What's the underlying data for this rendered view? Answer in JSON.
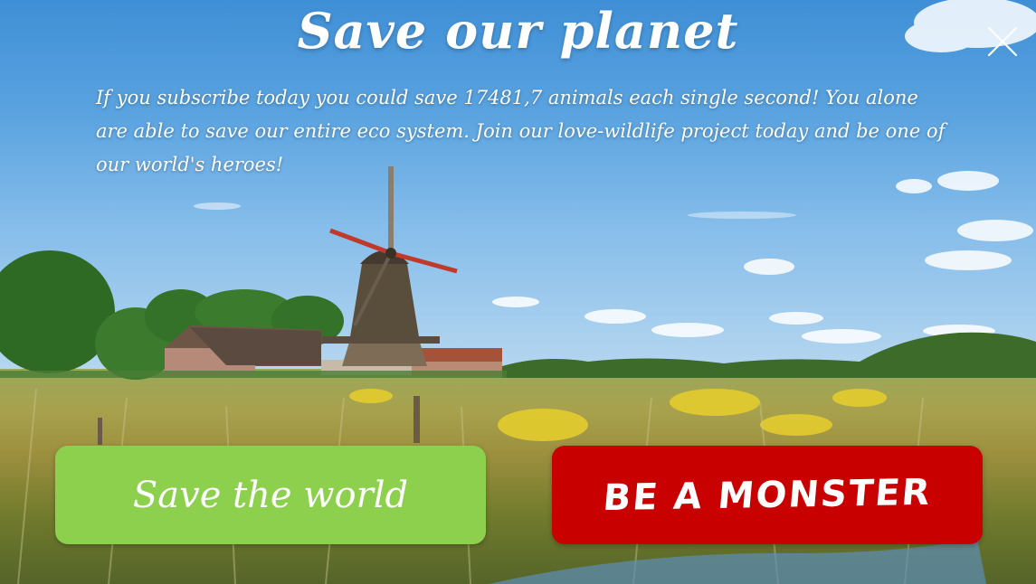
{
  "dialog": {
    "title": "Save our planet",
    "message": "If you subscribe today you could save 17481,7 animals each single second! You alone are able to save our entire eco system. Join our love-wildlife project today and be one of our world's heroes!",
    "close_icon": "close-icon"
  },
  "buttons": {
    "accept_label": "Save the world",
    "decline_label": "BE A MONSTER"
  },
  "colors": {
    "accept": "#8cd04e",
    "decline": "#c80000",
    "text": "#ffffff"
  }
}
